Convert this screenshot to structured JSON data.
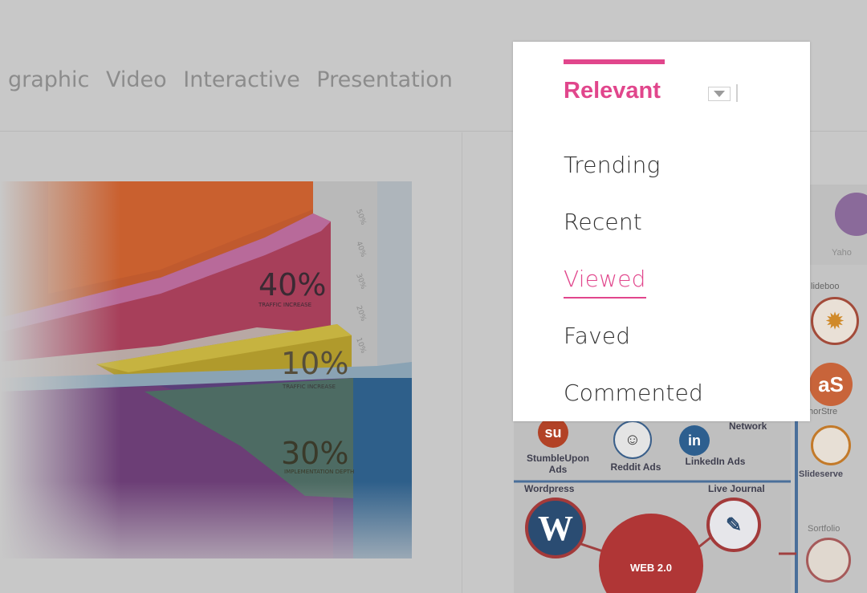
{
  "tabs": [
    "graphic",
    "Video",
    "Interactive",
    "Presentation"
  ],
  "left_card": {
    "labels": [
      {
        "big": "40%",
        "small": "TRAFFIC INCREASE"
      },
      {
        "big": "10%",
        "small": "TRAFFIC INCREASE"
      },
      {
        "big": "30%",
        "small": "IMPLEMENTATION DEPTH"
      }
    ],
    "scale_ticks": [
      "50%",
      "40%",
      "30%",
      "20%",
      "10%"
    ]
  },
  "right_card": {
    "labels": {
      "yahoo": "Yaho",
      "slideboom": "lideboo",
      "authorstream": "thorStre",
      "slideserve": "Slideserve",
      "portfolio": "Sortfolio",
      "stumbleupon": "StumbleUpon\nAds",
      "reddit": "Reddit Ads",
      "linkedin": "LinkedIn Ads",
      "network": "Network",
      "wordpress": "Wordpress",
      "livejournal": "Live Journal",
      "web20": "WEB 2.0"
    }
  },
  "sort_dropdown": {
    "current": "Relevant",
    "options": [
      {
        "label": "Trending",
        "active": false
      },
      {
        "label": "Recent",
        "active": false
      },
      {
        "label": "Viewed",
        "active": true
      },
      {
        "label": "Faved",
        "active": false
      },
      {
        "label": "Commented",
        "active": false
      }
    ]
  },
  "colors": {
    "accent": "#e1468c",
    "overlay": "#c8c8c8"
  }
}
